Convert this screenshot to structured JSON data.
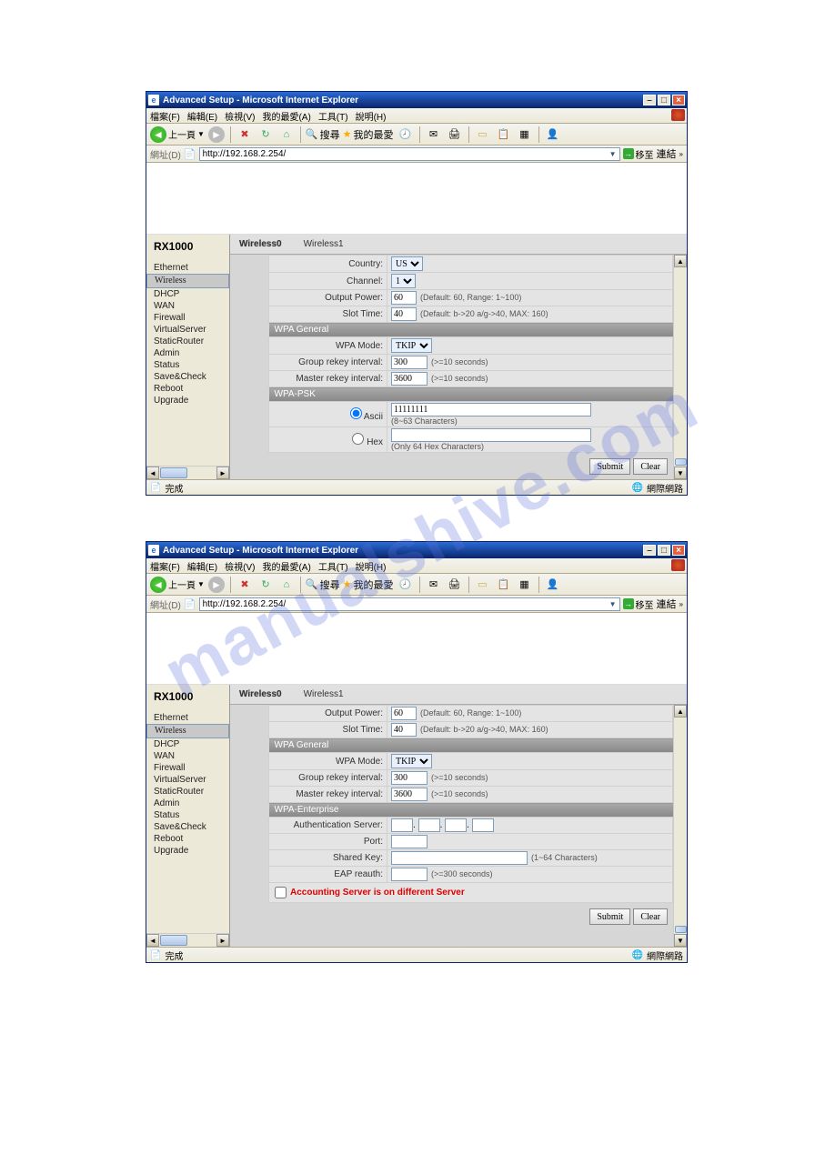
{
  "watermark": "manualshive.com",
  "window": {
    "title": "Advanced Setup - Microsoft Internet Explorer",
    "minimize": "–",
    "maximize": "□",
    "close": "×"
  },
  "menu": {
    "file": "檔案(F)",
    "edit": "編輯(E)",
    "view": "檢視(V)",
    "favorites": "我的最愛(A)",
    "tools": "工具(T)",
    "help": "說明(H)"
  },
  "toolbar": {
    "back": "上一頁",
    "search": "搜尋",
    "favorites": "我的最愛"
  },
  "addressbar": {
    "label": "網址(D)",
    "url": "http://192.168.2.254/",
    "go": "移至",
    "links": "連結"
  },
  "brand": "RX1000",
  "nav": [
    {
      "label": "Ethernet",
      "sel": false
    },
    {
      "label": "Wireless",
      "sel": true
    },
    {
      "label": "DHCP",
      "sel": false
    },
    {
      "label": "WAN",
      "sel": false
    },
    {
      "label": "Firewall",
      "sel": false
    },
    {
      "label": "VirtualServer",
      "sel": false
    },
    {
      "label": "StaticRouter",
      "sel": false
    },
    {
      "label": "Admin",
      "sel": false
    },
    {
      "label": "Status",
      "sel": false
    },
    {
      "label": "Save&Check",
      "sel": false
    },
    {
      "label": "Reboot",
      "sel": false
    },
    {
      "label": "Upgrade",
      "sel": false
    }
  ],
  "tabs": {
    "t0": "Wireless0",
    "t1": "Wireless1"
  },
  "screen1": {
    "country": {
      "label": "Country:",
      "value": "US"
    },
    "channel": {
      "label": "Channel:",
      "value": "1"
    },
    "output_power": {
      "label": "Output Power:",
      "value": "60",
      "hint": "(Default: 60, Range: 1~100)"
    },
    "slot_time": {
      "label": "Slot Time:",
      "value": "40",
      "hint": "(Default: b->20 a/g->40, MAX: 160)"
    },
    "wpa_general_hdr": "WPA General",
    "wpa_mode": {
      "label": "WPA Mode:",
      "value": "TKIP"
    },
    "group_rekey": {
      "label": "Group rekey interval:",
      "value": "300",
      "hint": "(>=10 seconds)"
    },
    "master_rekey": {
      "label": "Master rekey interval:",
      "value": "3600",
      "hint": "(>=10 seconds)"
    },
    "wpa_psk_hdr": "WPA-PSK",
    "ascii": {
      "label": "Ascii",
      "value": "11111111",
      "hint": "(8~63 Characters)"
    },
    "hex": {
      "label": "Hex",
      "value": "",
      "hint": "(Only 64 Hex Characters)"
    },
    "submit": "Submit",
    "clear": "Clear"
  },
  "screen2": {
    "output_power": {
      "label": "Output Power:",
      "value": "60",
      "hint": "(Default: 60, Range: 1~100)"
    },
    "slot_time": {
      "label": "Slot Time:",
      "value": "40",
      "hint": "(Default: b->20 a/g->40, MAX: 160)"
    },
    "wpa_general_hdr": "WPA General",
    "wpa_mode": {
      "label": "WPA Mode:",
      "value": "TKIP"
    },
    "group_rekey": {
      "label": "Group rekey interval:",
      "value": "300",
      "hint": "(>=10 seconds)"
    },
    "master_rekey": {
      "label": "Master rekey interval:",
      "value": "3600",
      "hint": "(>=10 seconds)"
    },
    "wpa_enterprise_hdr": "WPA-Enterprise",
    "auth_server": {
      "label": "Authentication Server:"
    },
    "port": {
      "label": "Port:"
    },
    "shared_key": {
      "label": "Shared Key:",
      "hint": "(1~64 Characters)"
    },
    "eap_reauth": {
      "label": "EAP reauth:",
      "hint": "(>=300 seconds)"
    },
    "accounting": "Accounting Server is on different Server",
    "submit": "Submit",
    "clear": "Clear"
  },
  "statusbar": {
    "done": "完成",
    "zone": "網際網路"
  }
}
